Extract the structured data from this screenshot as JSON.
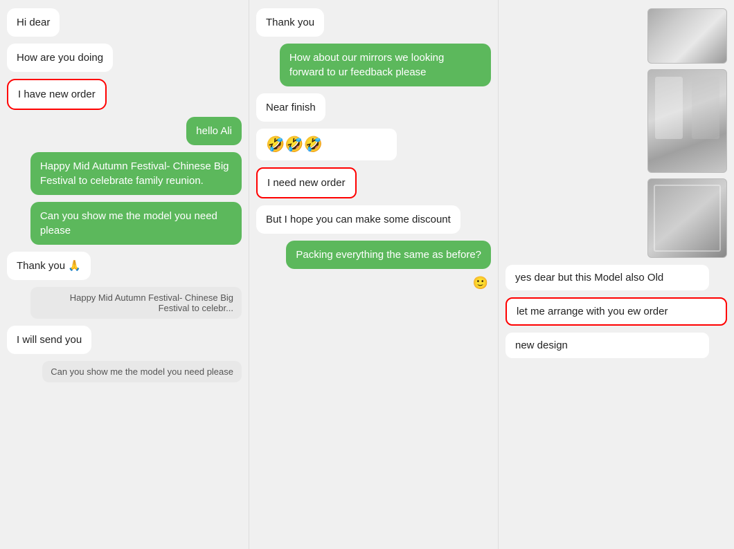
{
  "col1": {
    "messages": [
      {
        "id": "hi-dear",
        "text": "Hi dear",
        "type": "left"
      },
      {
        "id": "how-are-you",
        "text": "How are you doing",
        "type": "left"
      },
      {
        "id": "i-have-new-order",
        "text": "I have new order",
        "type": "outlined-left"
      },
      {
        "id": "hello-ali",
        "text": "hello Ali",
        "type": "right"
      },
      {
        "id": "happy-festival",
        "text": "Happy Mid Autumn Festival- Chinese Big Festival to celebrate family reunion.",
        "type": "right-green"
      },
      {
        "id": "can-you-show",
        "text": "Can you show me the model you need please",
        "type": "right-green"
      },
      {
        "id": "thank-you-pray",
        "text": "Thank you 🙏",
        "type": "left"
      },
      {
        "id": "quote-festival",
        "text": "Happy Mid Autumn Festival- Chinese Big Festival to celebr...",
        "type": "quote"
      },
      {
        "id": "i-will-send",
        "text": "I will send you",
        "type": "left"
      },
      {
        "id": "quote-show",
        "text": "Can you show me the model you need please",
        "type": "quote"
      }
    ]
  },
  "col2": {
    "messages": [
      {
        "id": "thank-you",
        "text": "Thank you",
        "type": "left"
      },
      {
        "id": "how-about-mirrors",
        "text": "How about our mirrors we looking forward to ur feedback please",
        "type": "right-green"
      },
      {
        "id": "near-finish",
        "text": "Near finish",
        "type": "left"
      },
      {
        "id": "emoji-row",
        "text": "🤣🤣🤣",
        "type": "emoji"
      },
      {
        "id": "i-need-new-order",
        "text": "I need new order",
        "type": "outlined-left"
      },
      {
        "id": "but-hope-discount",
        "text": "But I hope you can make some discount",
        "type": "left"
      },
      {
        "id": "packing-same",
        "text": "Packing everything the same as before?",
        "type": "right-green"
      },
      {
        "id": "emoji-icon-send",
        "text": "🙂",
        "type": "emoji-icon"
      }
    ]
  },
  "col3": {
    "images": [
      {
        "id": "mirror-img-1",
        "label": "mirror photo 1"
      },
      {
        "id": "mirror-img-2",
        "label": "mirror photo 2"
      },
      {
        "id": "mirror-img-3",
        "label": "mirror photo 3"
      }
    ],
    "messages": [
      {
        "id": "yes-dear-old",
        "text": "yes dear but this Model also Old",
        "type": "left"
      },
      {
        "id": "let-me-arrange",
        "text": "let me arrange with you ew order",
        "type": "outlined-left"
      },
      {
        "id": "new-design",
        "text": "new design",
        "type": "left"
      }
    ]
  }
}
